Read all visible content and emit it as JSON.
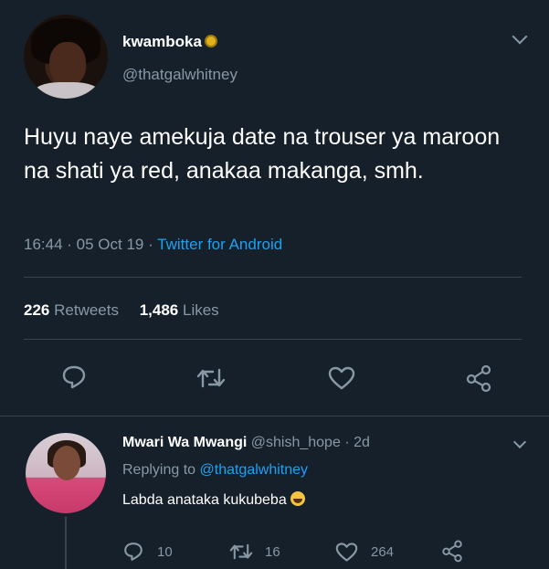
{
  "tweet": {
    "display_name": "kwamboka",
    "handle": "@thatgalwhitney",
    "text": "Huyu naye amekuja date na trouser ya maroon na shati ya red, anakaa makanga, smh.",
    "time": "16:44 · 05 Oct 19 · ",
    "source": "Twitter for Android",
    "retweets_count": "226",
    "retweets_label": "Retweets",
    "likes_count": "1,486",
    "likes_label": "Likes"
  },
  "reply": {
    "display_name": "Mwari Wa Mwangi",
    "handle": "@shish_hope",
    "age": "· 2d",
    "replying_prefix": "Replying to ",
    "replying_to": "@thatgalwhitney",
    "text": "Labda anataka kukubeba",
    "reply_count": "10",
    "retweet_count": "16",
    "like_count": "264"
  },
  "icons": {
    "reply": "reply-icon",
    "retweet": "retweet-icon",
    "like": "heart-icon",
    "share": "share-icon",
    "menu": "chevron-down-icon"
  },
  "colors": {
    "background": "#15202b",
    "accent": "#1da1f2",
    "secondary_text": "#8899a6",
    "divider": "#38444d"
  }
}
